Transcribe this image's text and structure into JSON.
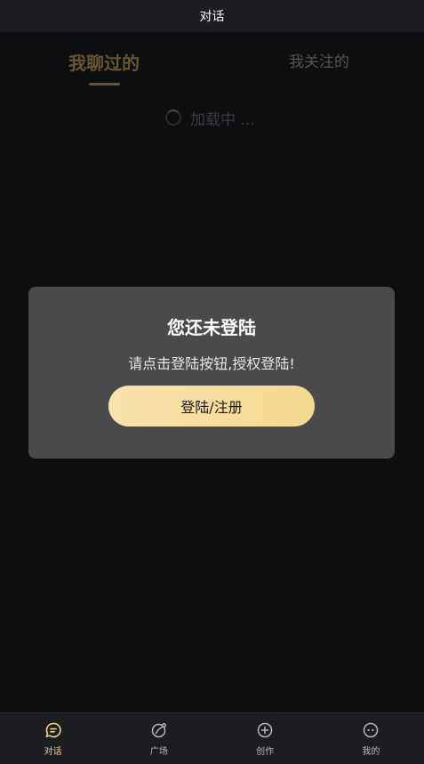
{
  "header": {
    "title": "对话"
  },
  "tabs": {
    "active_label": "我聊过的",
    "inactive_label": "我关注的"
  },
  "loading": {
    "text": "加载中 ..."
  },
  "login_modal": {
    "title": "您还未登陆",
    "message": "请点击登陆按钮,授权登陆!",
    "button_label": "登陆/注册"
  },
  "bottom_nav": {
    "items": [
      {
        "label": "对话",
        "icon": "chat-bubble-icon",
        "active": true
      },
      {
        "label": "广场",
        "icon": "plaza-icon",
        "active": false
      },
      {
        "label": "创作",
        "icon": "plus-circle-icon",
        "active": false
      },
      {
        "label": "我的",
        "icon": "profile-face-icon",
        "active": false
      }
    ]
  },
  "colors": {
    "accent": "#f4d48a",
    "button_gradient_start": "#f9e2ad",
    "button_gradient_end": "#f5d98f",
    "background": "#0d0e10",
    "modal_background": "#4a4a4d"
  }
}
